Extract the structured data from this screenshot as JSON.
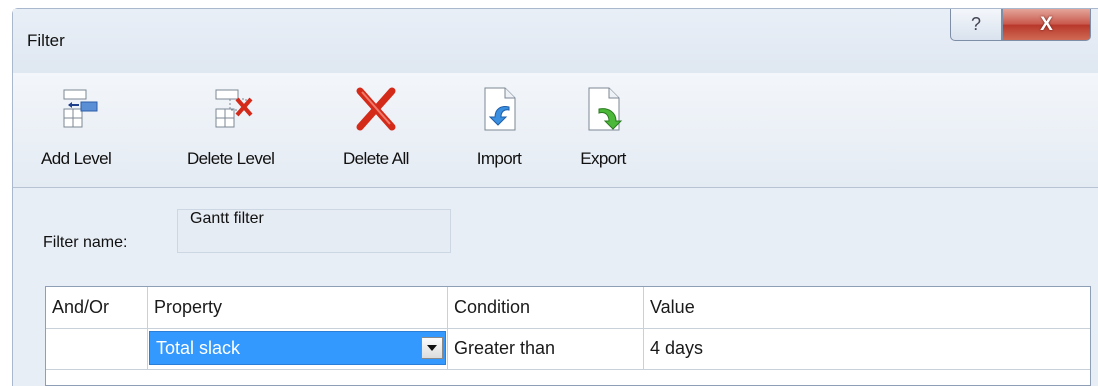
{
  "window": {
    "title": "Filter",
    "help_label": "?",
    "close_label": "X"
  },
  "toolbar": {
    "buttons": [
      {
        "label": "Add Level",
        "icon": "add-level-icon"
      },
      {
        "label": "Delete Level",
        "icon": "delete-level-icon"
      },
      {
        "label": "Delete All",
        "icon": "delete-all-icon"
      },
      {
        "label": "Import",
        "icon": "import-icon"
      },
      {
        "label": "Export",
        "icon": "export-icon"
      }
    ]
  },
  "filter_name": {
    "label": "Filter name:",
    "value": "Gantt filter"
  },
  "grid": {
    "columns": [
      "And/Or",
      "Property",
      "Condition",
      "Value"
    ],
    "rows": [
      {
        "and_or": "",
        "property": "Total slack",
        "condition": "Greater than",
        "value": "4 days"
      }
    ]
  },
  "colors": {
    "selection": "#3399ff",
    "close_button": "#c8564a",
    "window_bg": "#e8eef6"
  }
}
